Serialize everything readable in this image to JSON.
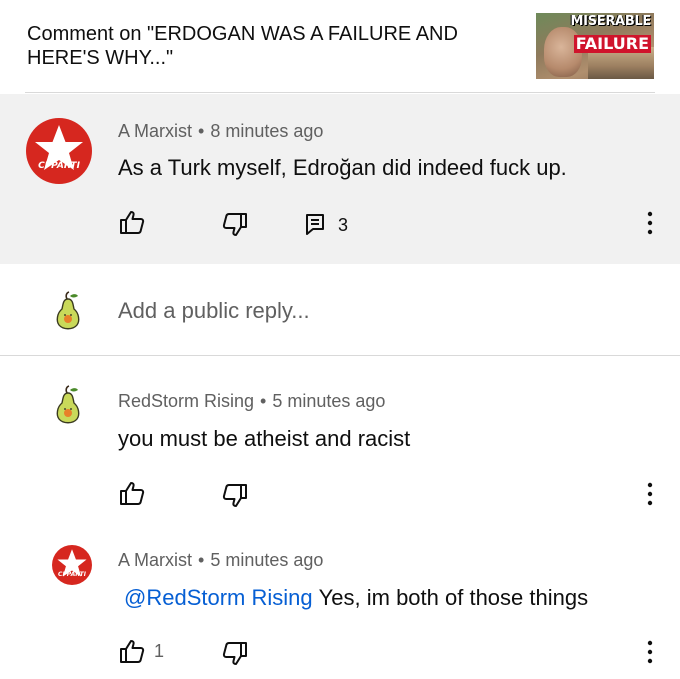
{
  "header": {
    "title": "Comment on \"ERDOGAN WAS A FAILURE AND HERE'S WHY...\"",
    "thumbnail": {
      "line1": "MISERABLE",
      "line2": "FAILURE"
    }
  },
  "main_comment": {
    "author": "A Marxist",
    "time": "8 minutes ago",
    "text": "As a Turk myself, Edroğan did indeed fuck up.",
    "reply_count": "3",
    "avatar_text": "CI PARTI"
  },
  "reply_input": {
    "placeholder": "Add a public reply..."
  },
  "replies": [
    {
      "author": "RedStorm Rising",
      "time": "5 minutes ago",
      "text": "you must be atheist and racist",
      "likes": ""
    },
    {
      "author": "A Marxist",
      "time": "5 minutes ago",
      "mention": "@RedStorm Rising",
      "text": "Yes, im both of those things",
      "likes": "1",
      "avatar_text": "CI PARTI"
    }
  ],
  "colors": {
    "accent_red": "#d6271f",
    "link_blue": "#065fd4",
    "meta_grey": "#606060",
    "panel_bg": "#f1f1f1"
  },
  "icons": [
    "thumbs-up-icon",
    "thumbs-down-icon",
    "reply-icon",
    "more-vert-icon",
    "pear-avatar-icon",
    "star-avatar-icon"
  ]
}
